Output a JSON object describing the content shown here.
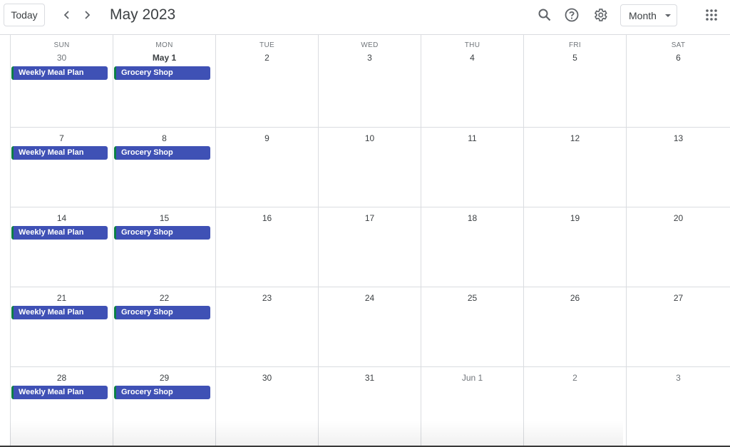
{
  "header": {
    "today_label": "Today",
    "title": "May 2023",
    "view_select": "Month",
    "icons": [
      "chevron-left-icon",
      "chevron-right-icon",
      "search-icon",
      "help-icon",
      "gear-icon",
      "apps-grid-icon"
    ]
  },
  "days_of_week": [
    "SUN",
    "MON",
    "TUE",
    "WED",
    "THU",
    "FRI",
    "SAT"
  ],
  "weeks": [
    [
      {
        "label": "30",
        "style": "muted"
      },
      {
        "label": "May 1",
        "style": "bold"
      },
      {
        "label": "2"
      },
      {
        "label": "3"
      },
      {
        "label": "4"
      },
      {
        "label": "5"
      },
      {
        "label": "6"
      }
    ],
    [
      {
        "label": "7"
      },
      {
        "label": "8"
      },
      {
        "label": "9"
      },
      {
        "label": "10"
      },
      {
        "label": "11"
      },
      {
        "label": "12"
      },
      {
        "label": "13"
      }
    ],
    [
      {
        "label": "14"
      },
      {
        "label": "15"
      },
      {
        "label": "16"
      },
      {
        "label": "17"
      },
      {
        "label": "18"
      },
      {
        "label": "19"
      },
      {
        "label": "20"
      }
    ],
    [
      {
        "label": "21"
      },
      {
        "label": "22"
      },
      {
        "label": "23"
      },
      {
        "label": "24"
      },
      {
        "label": "25"
      },
      {
        "label": "26"
      },
      {
        "label": "27"
      }
    ],
    [
      {
        "label": "28"
      },
      {
        "label": "29"
      },
      {
        "label": "30"
      },
      {
        "label": "31"
      },
      {
        "label": "Jun 1",
        "style": "muted"
      },
      {
        "label": "2",
        "style": "muted"
      },
      {
        "label": "3",
        "style": "muted"
      }
    ]
  ],
  "events": [
    {
      "week": 0,
      "day": 0,
      "title": "Weekly Meal Plan"
    },
    {
      "week": 0,
      "day": 1,
      "title": "Grocery Shop"
    },
    {
      "week": 1,
      "day": 0,
      "title": "Weekly Meal Plan"
    },
    {
      "week": 1,
      "day": 1,
      "title": "Grocery Shop"
    },
    {
      "week": 2,
      "day": 0,
      "title": "Weekly Meal Plan"
    },
    {
      "week": 2,
      "day": 1,
      "title": "Grocery Shop"
    },
    {
      "week": 3,
      "day": 0,
      "title": "Weekly Meal Plan"
    },
    {
      "week": 3,
      "day": 1,
      "title": "Grocery Shop"
    },
    {
      "week": 4,
      "day": 0,
      "title": "Weekly Meal Plan"
    },
    {
      "week": 4,
      "day": 1,
      "title": "Grocery Shop"
    }
  ],
  "colors": {
    "event_bg": "#3f51b5",
    "event_edge": "#0b8043"
  }
}
